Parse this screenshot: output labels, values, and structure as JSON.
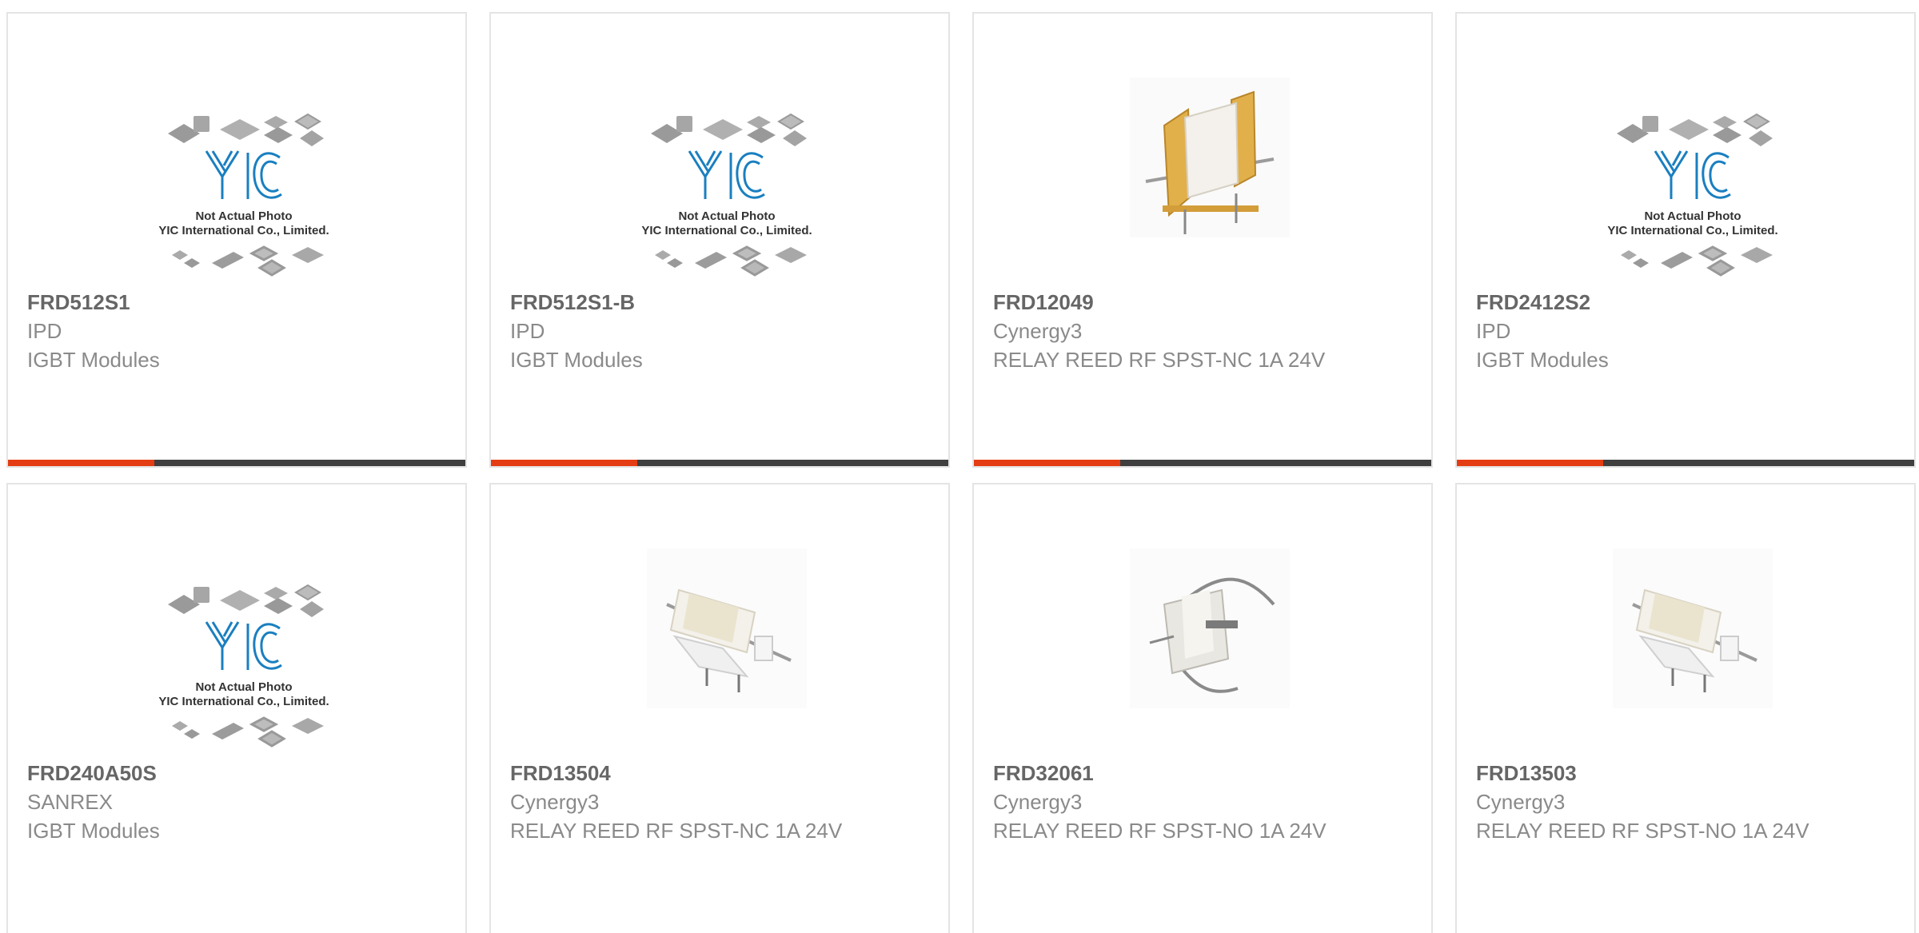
{
  "colors": {
    "accent": "#e43d13",
    "bar": "#3f3f3f",
    "part_number": "#666666",
    "secondary_text": "#8a8a8a",
    "logo_blue": "#1a7fc0"
  },
  "placeholder_image": {
    "line1": "Not Actual Photo",
    "line2": "YIC International Co., Limited.",
    "logo_text": "YIC"
  },
  "products": [
    {
      "part_number": "FRD512S1",
      "manufacturer": "IPD",
      "description": "IGBT Modules",
      "image": "placeholder"
    },
    {
      "part_number": "FRD512S1-B",
      "manufacturer": "IPD",
      "description": "IGBT Modules",
      "image": "placeholder"
    },
    {
      "part_number": "FRD12049",
      "manufacturer": "Cynergy3",
      "description": "RELAY REED RF SPST-NC 1A 24V",
      "image": "relay-amber"
    },
    {
      "part_number": "FRD2412S2",
      "manufacturer": "IPD",
      "description": "IGBT Modules",
      "image": "placeholder"
    },
    {
      "part_number": "FRD240A50S",
      "manufacturer": "SANREX",
      "description": "IGBT Modules",
      "image": "placeholder"
    },
    {
      "part_number": "FRD13504",
      "manufacturer": "Cynergy3",
      "description": "RELAY REED RF SPST-NC 1A 24V",
      "image": "relay-white"
    },
    {
      "part_number": "FRD32061",
      "manufacturer": "Cynergy3",
      "description": "RELAY REED RF SPST-NO 1A 24V",
      "image": "relay-leads"
    },
    {
      "part_number": "FRD13503",
      "manufacturer": "Cynergy3",
      "description": "RELAY REED RF SPST-NO 1A 24V",
      "image": "relay-white"
    }
  ]
}
